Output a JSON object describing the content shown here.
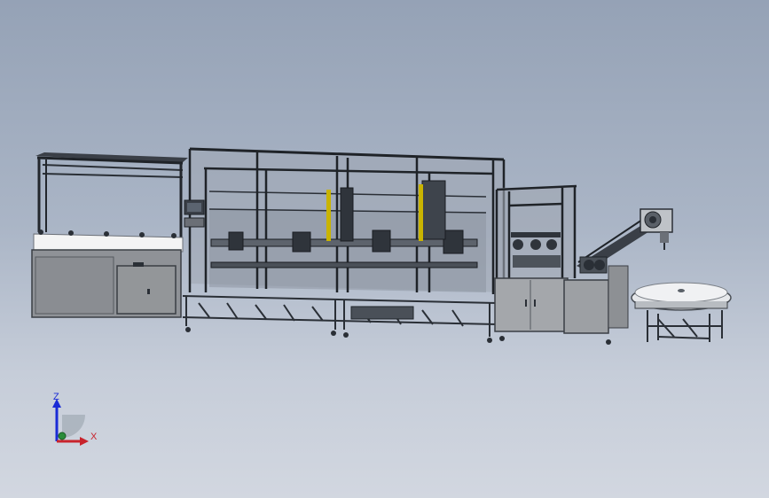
{
  "viewport": {
    "background_top": "#95a2b6",
    "background_bottom": "#d2d7e0"
  },
  "triad": {
    "z_label": "Z",
    "x_label": "X",
    "z_color": "#1a2bd6",
    "x_color": "#c8232c",
    "origin_color": "#2b8c3a"
  },
  "colors": {
    "frame": "#2a2f36",
    "panel_gray": "#8c8f94",
    "glass": "#9aa3b0",
    "light_metal": "#c9ccd0",
    "yellow": "#c9b400"
  }
}
